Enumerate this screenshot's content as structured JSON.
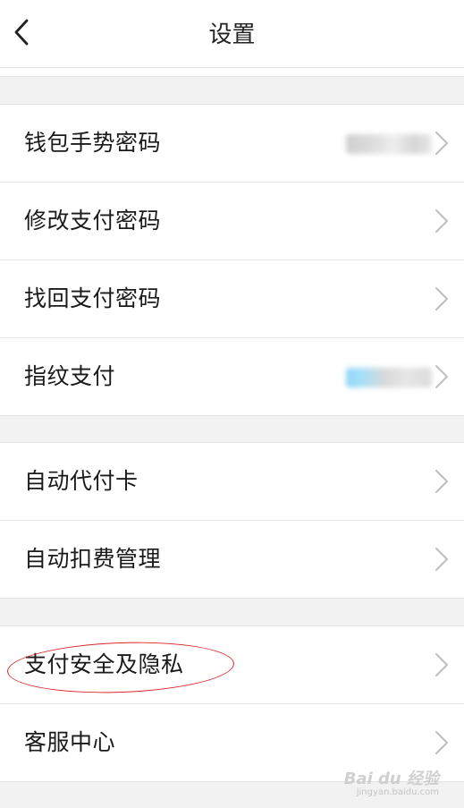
{
  "header": {
    "title": "设置"
  },
  "groups": [
    {
      "items": [
        {
          "label": "钱包手势密码"
        },
        {
          "label": "修改支付密码"
        },
        {
          "label": "找回支付密码"
        },
        {
          "label": "指纹支付"
        }
      ]
    },
    {
      "items": [
        {
          "label": "自动代付卡"
        },
        {
          "label": "自动扣费管理"
        }
      ]
    },
    {
      "items": [
        {
          "label": "支付安全及隐私"
        },
        {
          "label": "客服中心"
        }
      ]
    }
  ],
  "watermark": {
    "text": "Bai du 经验",
    "sub": "jingyan.baidu.com"
  },
  "colors": {
    "background": "#f2f2f2",
    "surface": "#ffffff",
    "annotation": "#d9262b",
    "chevron": "#bfbfbf"
  }
}
